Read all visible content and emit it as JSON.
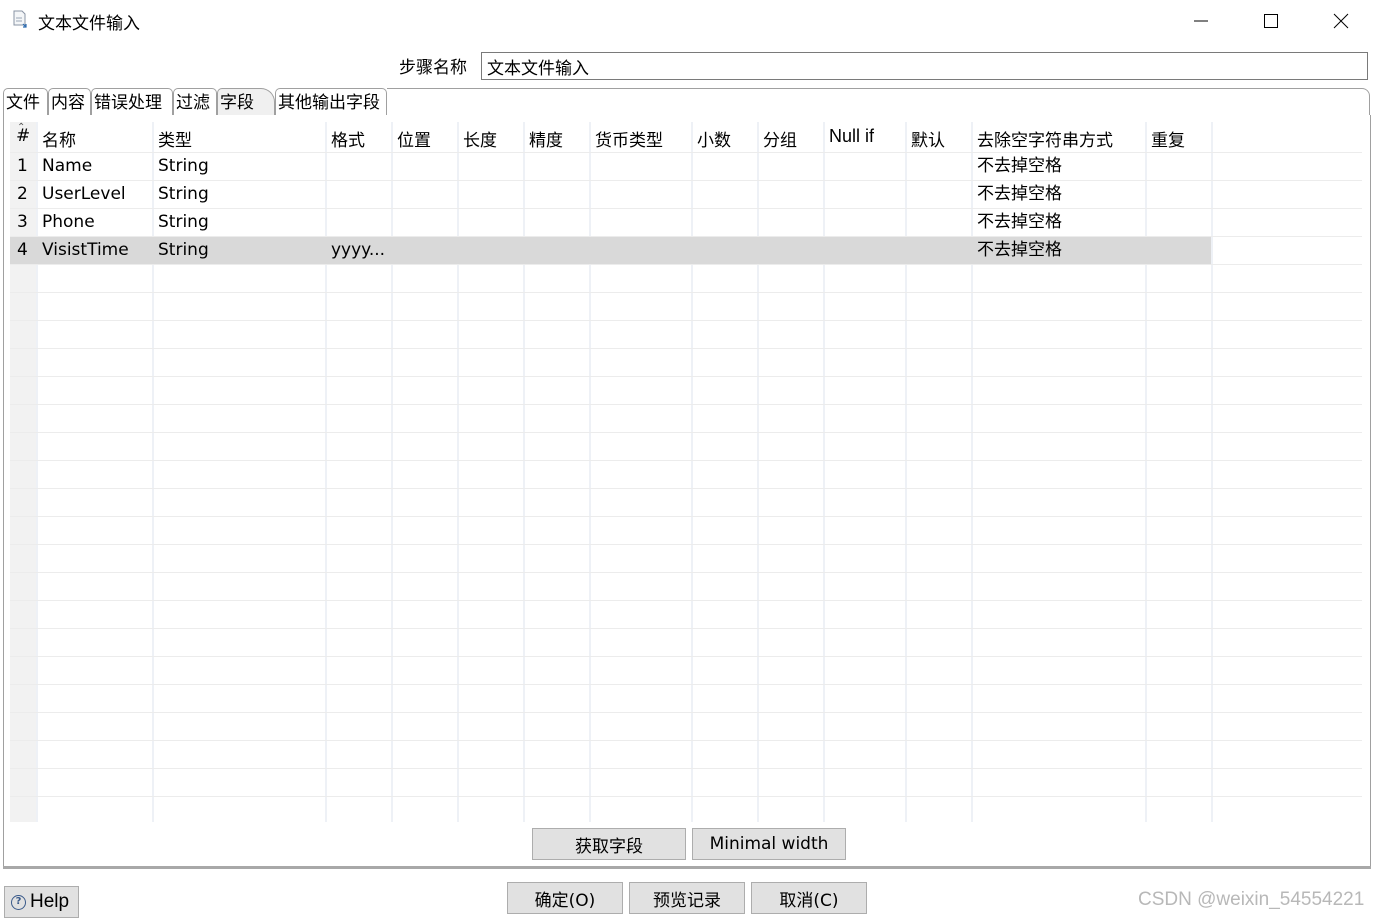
{
  "window": {
    "title": "文本文件输入",
    "icon": "document-icon",
    "controls": [
      "minimize-icon",
      "maximize-icon",
      "close-icon"
    ]
  },
  "step_name": {
    "label": "步骤名称",
    "value": "文本文件输入"
  },
  "tabs": [
    {
      "label": "文件",
      "active": false
    },
    {
      "label": "内容",
      "active": false
    },
    {
      "label": "错误处理",
      "active": false
    },
    {
      "label": "过滤",
      "active": false
    },
    {
      "label": "字段",
      "active": true
    },
    {
      "label": "其他输出字段",
      "active": false
    }
  ],
  "table": {
    "columns": [
      "#",
      "名称",
      "类型",
      "格式",
      "位置",
      "长度",
      "精度",
      "货币类型",
      "小数",
      "分组",
      "Null if",
      "默认",
      "去除空字符串方式",
      "重复"
    ],
    "rows": [
      {
        "num": "1",
        "name": "Name",
        "type": "String",
        "format": "",
        "trim": "不去掉空格",
        "selected": false
      },
      {
        "num": "2",
        "name": "UserLevel",
        "type": "String",
        "format": "",
        "trim": "不去掉空格",
        "selected": false
      },
      {
        "num": "3",
        "name": "Phone",
        "type": "String",
        "format": "",
        "trim": "不去掉空格",
        "selected": false
      },
      {
        "num": "4",
        "name": "VisistTime",
        "type": "String",
        "format": "yyyy...",
        "trim": "不去掉空格",
        "selected": true
      }
    ],
    "selected_row_color": "#d9d9d9"
  },
  "buttons": {
    "get_fields": "获取字段",
    "minimal_width": "Minimal width",
    "ok": "确定(O)",
    "preview": "预览记录",
    "cancel": "取消(C)",
    "help": "Help"
  },
  "watermark": "CSDN @weixin_54554221"
}
